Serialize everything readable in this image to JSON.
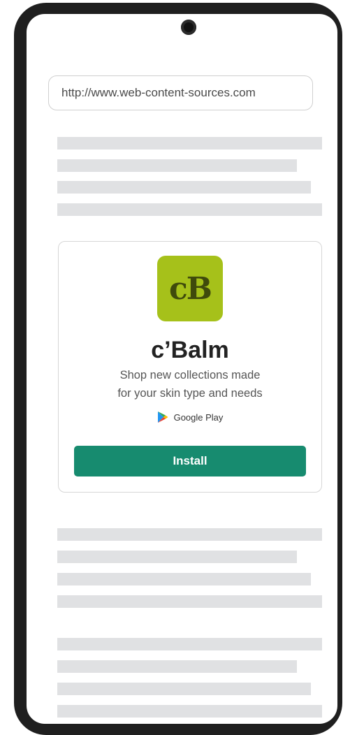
{
  "browser": {
    "url": "http://www.web-content-sources.com"
  },
  "ad_card": {
    "icon_text": "cB",
    "app_name": "c’Balm",
    "description_line1": "Shop new collections made",
    "description_line2": "for your skin type and needs",
    "store_label": "Google Play",
    "install_label": "Install",
    "colors": {
      "icon_bg": "#a6c11a",
      "install_button": "#178b6f"
    }
  },
  "placeholder_icons": [
    "play-store-icon",
    "camera-icon"
  ]
}
